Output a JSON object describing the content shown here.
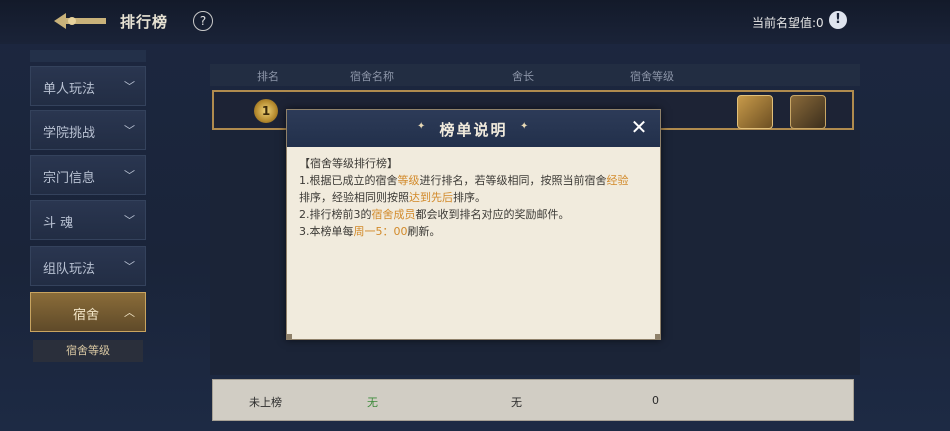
{
  "header": {
    "title": "排行榜",
    "help": "?",
    "prestige_label": "当前名望值:0",
    "info": "!"
  },
  "sidebar": {
    "items": [
      {
        "label": "单人玩法",
        "chev": "﹀"
      },
      {
        "label": "学院挑战",
        "chev": "﹀"
      },
      {
        "label": "宗门信息",
        "chev": "﹀"
      },
      {
        "label": "斗 魂",
        "chev": "﹀"
      },
      {
        "label": "组队玩法",
        "chev": "﹀"
      },
      {
        "label": "宿舍",
        "chev": "︿"
      }
    ],
    "sub_item": "宿舍等级"
  },
  "table": {
    "headers": [
      "排名",
      "宿舍名称",
      "舍长",
      "宿舍等级"
    ],
    "first_rank": "1"
  },
  "my_row": {
    "rank": "未上榜",
    "name": "无",
    "leader": "无",
    "level": "0"
  },
  "modal": {
    "title": "榜单说明",
    "deco_left": "✦",
    "deco_right": "✦",
    "close": "✕",
    "section": "【宿舍等级排行榜】",
    "l1a": "1.根据已成立的宿舍",
    "l1b": "等级",
    "l1c": "进行排名，若等级相同，按照当前宿舍",
    "l1d": "经验",
    "l2a": "排序，经验相同则按照",
    "l2b": "达到先后",
    "l2c": "排序。",
    "l3a": "2.排行榜前3的",
    "l3b": "宿舍成员",
    "l3c": "都会收到排名对应的奖励邮件。",
    "l4a": "3.本榜单每",
    "l4b": "周一5：00",
    "l4c": "刷新。"
  },
  "colors": {
    "highlight": "#d28a2a",
    "gold_border": "#b08b4e",
    "bottom_name_green": "#3c8a3a"
  },
  "icons": [
    "back-arrow-icon",
    "help-icon",
    "info-icon",
    "rank-medal-icon",
    "reward-crystal-icon",
    "reward-chest-icon",
    "close-icon"
  ]
}
